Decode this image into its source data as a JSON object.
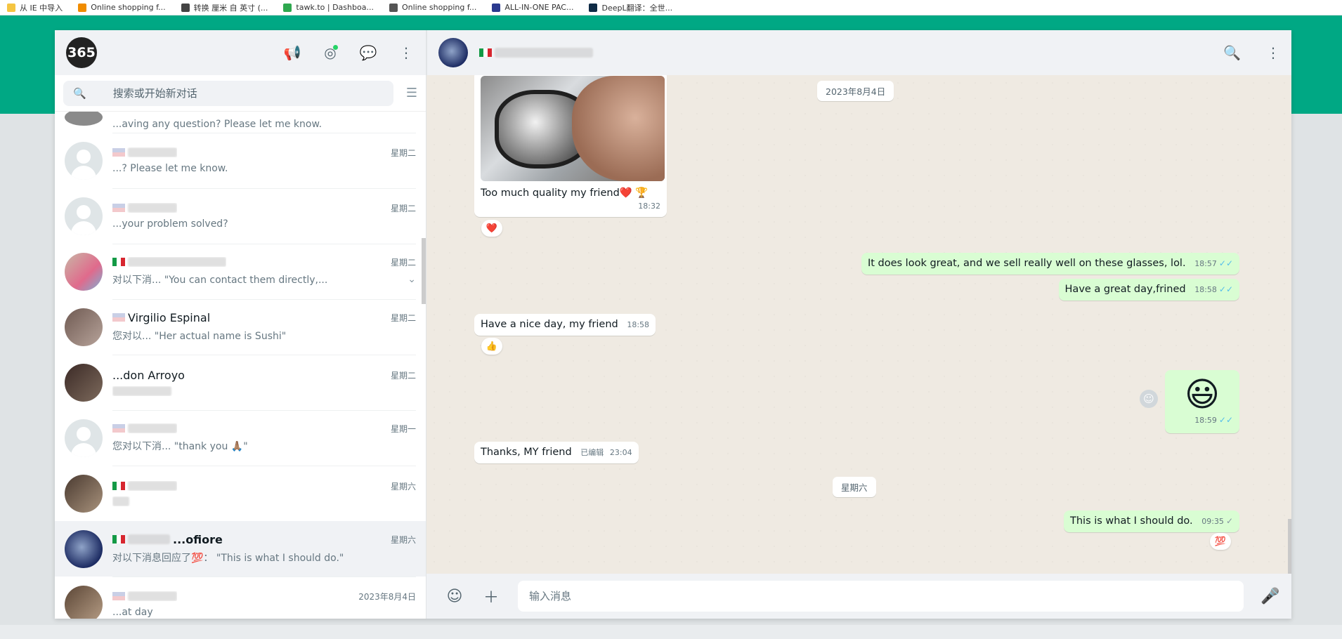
{
  "bookmarks": [
    {
      "label": "从 IE 中导入",
      "color": "#f5c542"
    },
    {
      "label": "Online shopping f...",
      "color": "#f08c00"
    },
    {
      "label": "转换 厘米 自 英寸 (...",
      "color": "#444444"
    },
    {
      "label": "tawk.to | Dashboa...",
      "color": "#2fa84f"
    },
    {
      "label": "Online shopping f...",
      "color": "#555555"
    },
    {
      "label": "ALL-IN-ONE PAC...",
      "color": "#2b3a8f"
    },
    {
      "label": "DeepL翻译：全世...",
      "color": "#0f2b46"
    }
  ],
  "left": {
    "logo": "365",
    "search_placeholder": "搜索或开始新对话"
  },
  "chats": [
    {
      "name": "",
      "flag": "",
      "date": "",
      "preview": "...aving any question? Please let me know.",
      "active": false
    },
    {
      "name": "",
      "flag": "us",
      "date": "星期二",
      "preview": "...? Please let me know.",
      "active": false
    },
    {
      "name": "",
      "flag": "us",
      "date": "星期二",
      "preview": "...your problem solved?",
      "active": false
    },
    {
      "name": "",
      "flag": "it",
      "date": "星期二",
      "preview": "对以下消... \"You can contact them directly,...",
      "active": false,
      "chevron": true
    },
    {
      "name": "Virgilio Espinal",
      "flag": "us",
      "date": "星期二",
      "preview": "您对以... \"Her actual name is Sushi\"",
      "active": false
    },
    {
      "name": "...don Arroyo",
      "flag": "",
      "date": "星期二",
      "preview": "",
      "active": false
    },
    {
      "name": "",
      "flag": "us",
      "date": "星期一",
      "preview": "您对以下消... \"thank you 🙏🏽\"",
      "active": false
    },
    {
      "name": "",
      "flag": "it",
      "date": "星期六",
      "preview": "",
      "active": false
    },
    {
      "name": "...ofiore",
      "flag": "it",
      "date": "星期六",
      "preview": "对以下消息回应了💯： \"This is what I should do.\"",
      "active": true
    },
    {
      "name": "",
      "flag": "us",
      "date": "2023年8月4日",
      "preview": "...at day",
      "active": false
    }
  ],
  "conversation": {
    "flag": "it",
    "date_chip_1": "2023年8月4日",
    "msg1": {
      "text": "Too much quality my friend❤️ 🏆",
      "time": "18:32",
      "reaction": "❤️"
    },
    "msg2": {
      "text": "It does look great, and we sell really well on these glasses, lol.",
      "time": "18:57"
    },
    "msg3": {
      "text": "Have a great day,frined",
      "time": "18:58"
    },
    "msg4": {
      "text": "Have a nice day, my friend",
      "time": "18:58",
      "reaction": "👍"
    },
    "msg5": {
      "emoji": "😃",
      "time": "18:59"
    },
    "msg6": {
      "text": "Thanks, MY friend",
      "edited": "已编辑",
      "time": "23:04"
    },
    "date_chip_2": "星期六",
    "msg7": {
      "text": "This is what I should do.",
      "time": "09:35",
      "reaction": "💯"
    }
  },
  "composer": {
    "placeholder": "输入消息"
  }
}
